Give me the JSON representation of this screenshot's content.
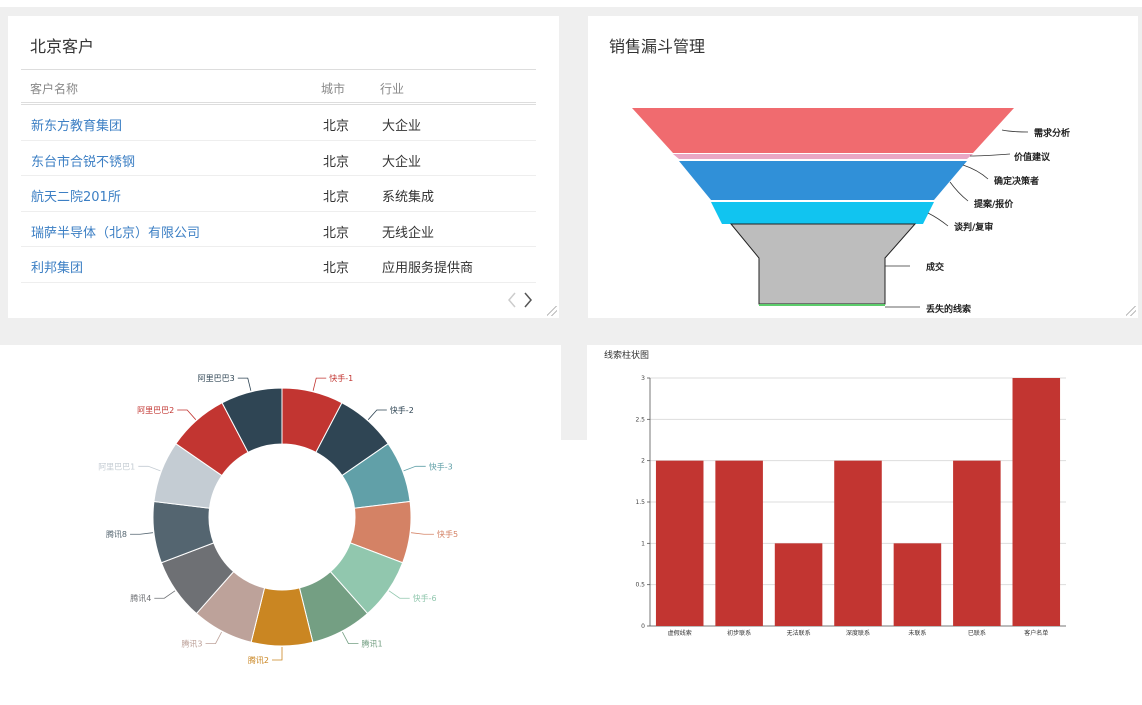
{
  "customers": {
    "title": "北京客户",
    "columns": [
      "客户名称",
      "城市",
      "行业"
    ],
    "rows": [
      {
        "name": "新东方教育集团",
        "city": "北京",
        "industry": "大企业"
      },
      {
        "name": "东台市合锐不锈钢",
        "city": "北京",
        "industry": "大企业"
      },
      {
        "name": "航天二院201所",
        "city": "北京",
        "industry": "系统集成"
      },
      {
        "name": "瑞萨半导体（北京）有限公司",
        "city": "北京",
        "industry": "无线企业"
      },
      {
        "name": "利邦集团",
        "city": "北京",
        "industry": "应用服务提供商"
      }
    ],
    "prev_icon": "chevron-left-icon",
    "next_icon": "chevron-right-icon"
  },
  "funnel": {
    "title": "销售漏斗管理",
    "stages": [
      {
        "label": "需求分析",
        "color": "#f06b6f"
      },
      {
        "label": "价值建议",
        "color": "#e9a7c4"
      },
      {
        "label": "确定决策者",
        "color": "#3090d8"
      },
      {
        "label": "提案/报价",
        "color": "#11c4f0"
      },
      {
        "label": "谈判/复审",
        "color": "#bdbdbd"
      },
      {
        "label": "成交",
        "color": "#bdbdbd"
      },
      {
        "label": "丢失的线索",
        "color": "#5ccc6b"
      }
    ]
  },
  "chart_data": [
    {
      "type": "pie",
      "variant": "donut",
      "title": "",
      "slices": [
        {
          "label": "快手-1",
          "value": 1,
          "color": "#c23531"
        },
        {
          "label": "快手-2",
          "value": 1,
          "color": "#2f4554"
        },
        {
          "label": "快手-3",
          "value": 1,
          "color": "#61a0a8"
        },
        {
          "label": "快手5",
          "value": 1,
          "color": "#d48265"
        },
        {
          "label": "快手-6",
          "value": 1,
          "color": "#91c7ae"
        },
        {
          "label": "腾讯1",
          "value": 1,
          "color": "#749f83"
        },
        {
          "label": "腾讯2",
          "value": 1,
          "color": "#ca8622"
        },
        {
          "label": "腾讯3",
          "value": 1,
          "color": "#bda29a"
        },
        {
          "label": "腾讯4",
          "value": 1,
          "color": "#6e7074"
        },
        {
          "label": "腾讯8",
          "value": 1,
          "color": "#546570"
        },
        {
          "label": "阿里巴巴1",
          "value": 1,
          "color": "#c4ccd3"
        },
        {
          "label": "阿里巴巴2",
          "value": 1,
          "color": "#c23531"
        },
        {
          "label": "阿里巴巴3",
          "value": 1,
          "color": "#2f4554"
        }
      ]
    },
    {
      "type": "bar",
      "title": "线索柱状图",
      "categories": [
        "虚假线索",
        "初步联系",
        "无法联系",
        "深度联系",
        "未联系",
        "已联系",
        "客户名单"
      ],
      "values": [
        2,
        2,
        1,
        2,
        1,
        2,
        3
      ],
      "ylim": [
        0,
        3
      ],
      "yticks": [
        "0",
        "0.5",
        "1",
        "1.5",
        "2",
        "2.5",
        "3"
      ],
      "color": "#c23531",
      "grid": true
    }
  ]
}
